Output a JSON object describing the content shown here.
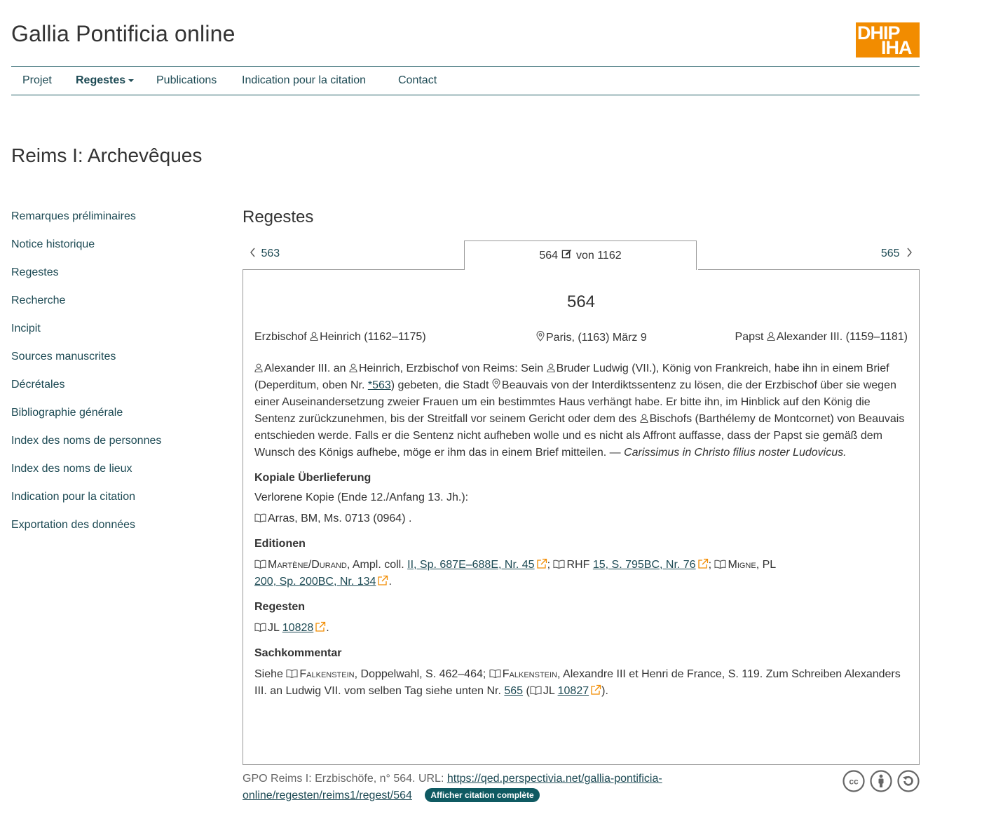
{
  "site": {
    "title": "Gallia Pontificia online",
    "logo_line1": "DHIP",
    "logo_line2": "IHA",
    "logo_color": "#f28c00",
    "accent_color": "#1d4a54"
  },
  "nav": {
    "items": [
      {
        "label": "Projet"
      },
      {
        "label": "Regestes",
        "active": true,
        "dropdown": true
      },
      {
        "label": "Publications"
      },
      {
        "label": "Indication pour la citation"
      },
      {
        "label": "Contact"
      }
    ]
  },
  "page": {
    "heading": "Reims I: Archevêques"
  },
  "sidebar": {
    "items": [
      {
        "label": "Remarques préliminaires"
      },
      {
        "label": "Notice historique"
      },
      {
        "label": "Regestes"
      },
      {
        "label": "Recherche"
      },
      {
        "label": "Incipit"
      },
      {
        "label": "Sources manuscrites"
      },
      {
        "label": "Décrétales"
      },
      {
        "label": "Bibliographie générale"
      },
      {
        "label": "Index des noms de personnes"
      },
      {
        "label": "Index des noms de lieux"
      },
      {
        "label": "Indication pour la citation"
      },
      {
        "label": "Exportation des données"
      }
    ]
  },
  "regestes": {
    "heading": "Regestes",
    "prev_label": "563",
    "next_label": "565",
    "current_number": "564",
    "current_of": "von 1162",
    "number": "564",
    "issuer_role": "Erzbischof",
    "issuer_name": "Heinrich (1162–1175)",
    "place_date": "Paris, (1163) März 9",
    "recipient_role": "Papst",
    "recipient_name": "Alexander III. (1159–1181)",
    "text": {
      "p1": "Alexander III. an",
      "p2": "Heinrich, Erzbischof von Reims: Sein",
      "p3": "Bruder Ludwig (VII.), König von Frankreich, habe ihn in einem Brief (Deperditum, oben Nr.",
      "link_563": "*563",
      "p4": ") gebeten, die Stadt",
      "p5": "Beauvais von der Interdiktssentenz zu lösen, die der Erzbischof über sie wegen einer Auseinandersetzung zweier Frauen um ein bestimmtes Haus verhängt habe. Er bitte ihn, im Hinblick auf den König die Sentenz zurückzunehmen, bis der Streitfall vor seinem Gericht oder dem des",
      "p6": "Bischofs (Barthélemy de Montcornet) von Beauvais entschieden werde. Falls er die Sentenz nicht aufheben wolle und es nicht als Affront auffasse, dass der Papst sie gemäß dem Wunsch des Königs aufhebe, möge er ihm das in einem Brief mitteilen. —",
      "incipit": "Carissimus in Christo filius noster Ludovicus."
    },
    "kopiale": {
      "title": "Kopiale Überlieferung",
      "line1": "Verlorene Kopie (Ende 12./Anfang 13. Jh.):",
      "line2": "Arras, BM, Ms. 0713 (0964)",
      "line2_end": "."
    },
    "editionen": {
      "title": "Editionen",
      "e1_author": "Martène/Durand",
      "e1_work": ", Ampl. coll.",
      "e1_link": "II, Sp. 687E–688E, Nr. 45",
      "sep1": ";",
      "e2_work": "RHF",
      "e2_link": "15, S. 795BC, Nr. 76",
      "sep2": ";",
      "e3_author": "Migne",
      "e3_work": ", PL",
      "e3_link": "200, Sp. 200BC, Nr. 134",
      "end": "."
    },
    "regesten": {
      "title": "Regesten",
      "work": "JL",
      "link": "10828",
      "end": "."
    },
    "sachkommentar": {
      "title": "Sachkommentar",
      "t1": "Siehe",
      "a1": "Falkenstein",
      "t2": ", Doppelwahl, S. 462–464;",
      "a2": "Falkenstein",
      "t3": ", Alexandre III et Henri de France, S. 119. Zum Schreiben Alexanders III. an Ludwig VII. vom selben Tag siehe unten Nr.",
      "link565": "565",
      "t4": "(",
      "t5": "JL",
      "link10827": "10827",
      "t6": ")."
    }
  },
  "footer": {
    "citation_text": "GPO Reims I: Erzbischöfe, n° 564. URL:",
    "url": "https://qed.perspectivia.net/gallia-pontificia-online/regesten/reims1/regest/564",
    "url_part1": "https://qed.perspectivia.net/gallia-pontificia-",
    "url_part2": "online/regesten/reims1/regest/564",
    "badge": "Afficher citation complète",
    "license_icons": [
      "cc-icon",
      "by-icon",
      "sa-icon"
    ]
  }
}
